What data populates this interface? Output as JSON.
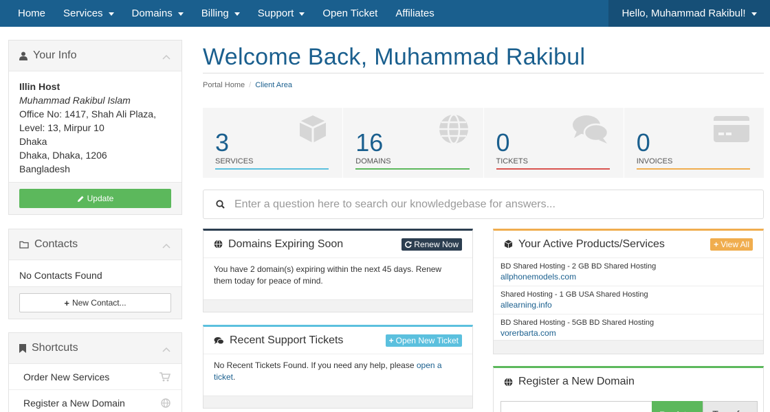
{
  "nav": {
    "items": [
      {
        "label": "Home",
        "dropdown": false
      },
      {
        "label": "Services",
        "dropdown": true
      },
      {
        "label": "Domains",
        "dropdown": true
      },
      {
        "label": "Billing",
        "dropdown": true
      },
      {
        "label": "Support",
        "dropdown": true
      },
      {
        "label": "Open Ticket",
        "dropdown": false
      },
      {
        "label": "Affiliates",
        "dropdown": false
      }
    ],
    "user_label": "Hello, Muhammad Rakibul!"
  },
  "sidebar": {
    "your_info": {
      "title": "Your Info",
      "company": "Illin Host",
      "name": "Muhammad Rakibul Islam",
      "address_lines": [
        "Office No: 1417, Shah Ali Plaza,",
        "Level: 13, Mirpur 10",
        "Dhaka",
        "Dhaka, Dhaka, 1206",
        "Bangladesh"
      ],
      "update_label": "Update"
    },
    "contacts": {
      "title": "Contacts",
      "empty_text": "No Contacts Found",
      "new_contact_label": "New Contact..."
    },
    "shortcuts": {
      "title": "Shortcuts",
      "items": [
        {
          "label": "Order New Services",
          "icon": "cart-icon"
        },
        {
          "label": "Register a New Domain",
          "icon": "globe-icon"
        }
      ]
    }
  },
  "main": {
    "title": "Welcome Back, Muhammad Rakibul",
    "breadcrumb": [
      "Portal Home",
      "Client Area"
    ],
    "tiles": [
      {
        "count": "3",
        "label": "SERVICES",
        "color": "#5bc0de",
        "icon": "cube-icon"
      },
      {
        "count": "16",
        "label": "DOMAINS",
        "color": "#5cb85c",
        "icon": "globe-icon"
      },
      {
        "count": "0",
        "label": "TICKETS",
        "color": "#d9534f",
        "icon": "comments-icon"
      },
      {
        "count": "0",
        "label": "INVOICES",
        "color": "#f0ad4e",
        "icon": "credit-card-icon"
      }
    ],
    "kb_search_placeholder": "Enter a question here to search our knowledgebase for answers...",
    "domains_expiring": {
      "title": "Domains Expiring Soon",
      "button": "Renew Now",
      "text": "You have 2 domain(s) expiring within the next 45 days. Renew them today for peace of mind."
    },
    "support_tickets": {
      "title": "Recent Support Tickets",
      "button": "Open New Ticket",
      "text": "No Recent Tickets Found. If you need any help, please",
      "link": "open a ticket",
      "tail": "."
    },
    "active_products": {
      "title": "Your Active Products/Services",
      "button": "View All",
      "items": [
        {
          "product": "BD Shared Hosting - 2 GB BD Shared Hosting",
          "domain": "allphonemodels.com"
        },
        {
          "product": "Shared Hosting - 1 GB USA Shared Hosting",
          "domain": "allearning.info"
        },
        {
          "product": "BD Shared Hosting - 5GB BD Shared Hosting",
          "domain": "vorerbarta.com"
        }
      ]
    },
    "register_domain": {
      "title": "Register a New Domain",
      "register_label": "Register",
      "transfer_label": "Transfer"
    }
  },
  "colors": {
    "nav_bg": "#1a5f8e",
    "accent": "#1a5f8e",
    "success": "#5cb85c",
    "info": "#5bc0de",
    "warning": "#f0ad4e",
    "danger": "#d9534f",
    "dark": "#2c3e50"
  }
}
